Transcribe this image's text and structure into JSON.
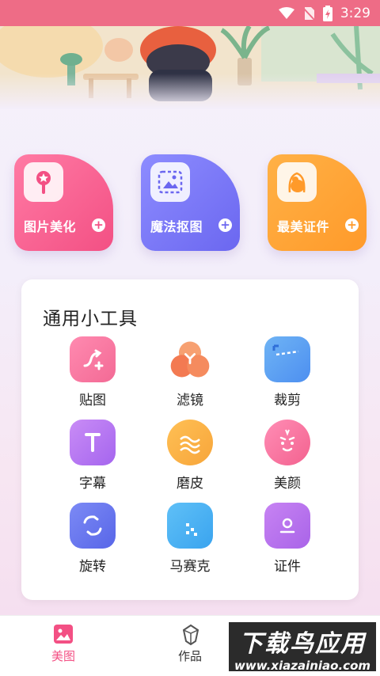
{
  "status_bar": {
    "time": "3:29",
    "bg_color": "#ee6c86"
  },
  "feature_cards": [
    {
      "label": "图片美化",
      "icon": "lollipop-icon",
      "color": "#f35084"
    },
    {
      "label": "魔法抠图",
      "icon": "image-select-icon",
      "color": "#6b67f0"
    },
    {
      "label": "最美证件",
      "icon": "portrait-icon",
      "color": "#ff9a2a"
    }
  ],
  "tools_panel": {
    "title": "通用小工具",
    "tools": [
      {
        "label": "贴图",
        "icon": "sticker-icon"
      },
      {
        "label": "滤镜",
        "icon": "filter-icon"
      },
      {
        "label": "裁剪",
        "icon": "crop-icon"
      },
      {
        "label": "字幕",
        "icon": "subtitle-icon"
      },
      {
        "label": "磨皮",
        "icon": "smooth-skin-icon"
      },
      {
        "label": "美颜",
        "icon": "beauty-face-icon"
      },
      {
        "label": "旋转",
        "icon": "rotate-icon"
      },
      {
        "label": "马赛克",
        "icon": "mosaic-icon"
      },
      {
        "label": "证件",
        "icon": "id-card-icon"
      }
    ]
  },
  "bottom_nav": {
    "items": [
      {
        "label": "美图",
        "icon": "image-icon",
        "active": true,
        "active_color": "#f35084"
      },
      {
        "label": "作品",
        "icon": "diamond-icon",
        "active": false
      }
    ]
  },
  "watermark": {
    "title": "下载鸟应用",
    "url": "www.xiazainiao.com"
  }
}
